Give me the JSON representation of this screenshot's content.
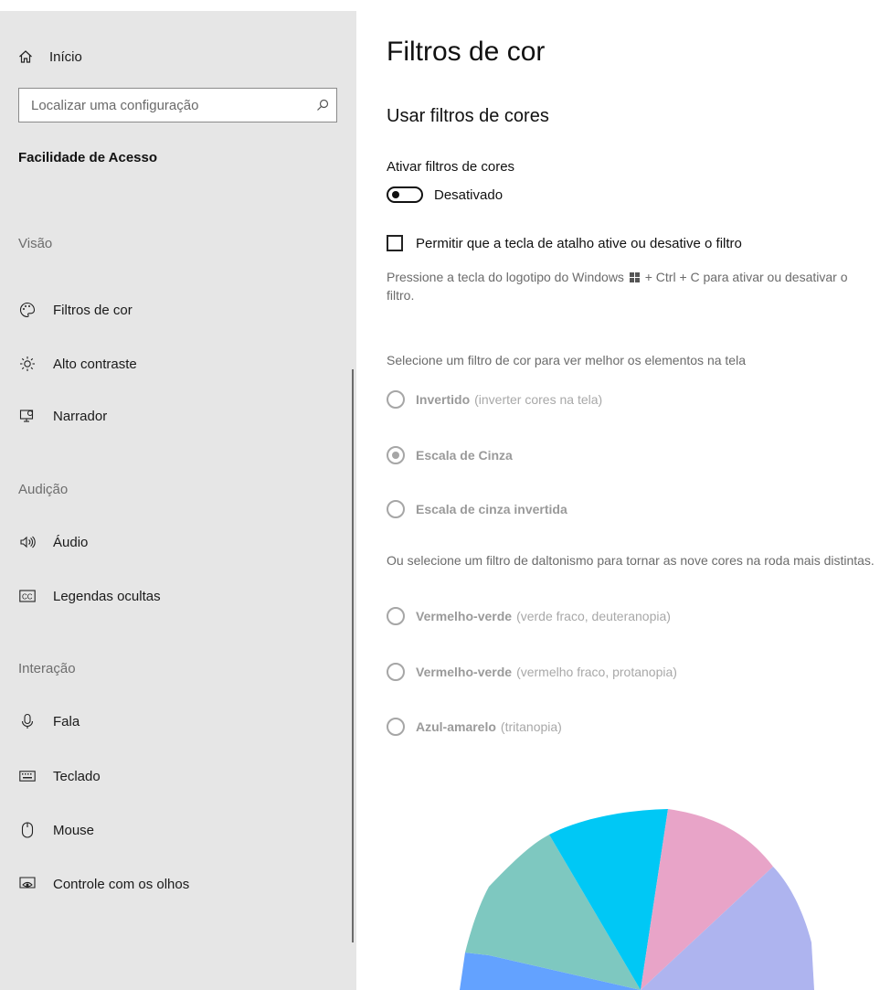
{
  "sidebar": {
    "home_label": "Início",
    "search_placeholder": "Localizar uma configuração",
    "category": "Facilidade de Acesso",
    "groups": {
      "vision": "Visão",
      "hearing": "Audição",
      "interaction": "Interação"
    },
    "items": [
      {
        "label": "Filtros de cor",
        "icon": "palette-icon"
      },
      {
        "label": "Alto contraste",
        "icon": "sun-icon"
      },
      {
        "label": "Narrador",
        "icon": "narrator-icon"
      },
      {
        "label": "Áudio",
        "icon": "speaker-icon"
      },
      {
        "label": "Legendas ocultas",
        "icon": "closed-captions-icon"
      },
      {
        "label": "Fala",
        "icon": "microphone-icon"
      },
      {
        "label": "Teclado",
        "icon": "keyboard-icon"
      },
      {
        "label": "Mouse",
        "icon": "mouse-icon"
      },
      {
        "label": "Controle com os olhos",
        "icon": "eye-control-icon"
      }
    ]
  },
  "main": {
    "title": "Filtros de cor",
    "section_title": "Usar filtros de cores",
    "toggle_label": "Ativar filtros de cores",
    "toggle_state_text": "Desativado",
    "toggle_on": false,
    "shortcut_checkbox_label": "Permitir que a tecla de atalho ative ou desative o filtro",
    "shortcut_checkbox_checked": false,
    "shortcut_desc_prefix": "Pressione a tecla do logotipo do Windows",
    "shortcut_desc_suffix": "+ Ctrl + C para ativar ou desativar o filtro.",
    "filter_prompt": "Selecione um filtro de cor para ver melhor os elementos na tela",
    "filters": [
      {
        "name": "Invertido",
        "note": "(inverter cores na tela)",
        "selected": false
      },
      {
        "name": "Escala de Cinza",
        "note": "",
        "selected": true
      },
      {
        "name": "Escala de cinza invertida",
        "note": "",
        "selected": false
      }
    ],
    "colorblind_prompt": "Ou selecione um filtro de daltonismo para tornar as nove cores na roda mais distintas.",
    "colorblind_filters": [
      {
        "name": "Vermelho-verde",
        "note": "(verde fraco, deuteranopia)",
        "selected": false
      },
      {
        "name": "Vermelho-verde",
        "note": "(vermelho fraco, protanopia)",
        "selected": false
      },
      {
        "name": "Azul-amarelo",
        "note": "(tritanopia)",
        "selected": false
      }
    ],
    "wheel_colors": [
      "#63a2ff",
      "#7ec8c0",
      "#00c8f5",
      "#e8a4c8",
      "#aeb4ef"
    ]
  }
}
